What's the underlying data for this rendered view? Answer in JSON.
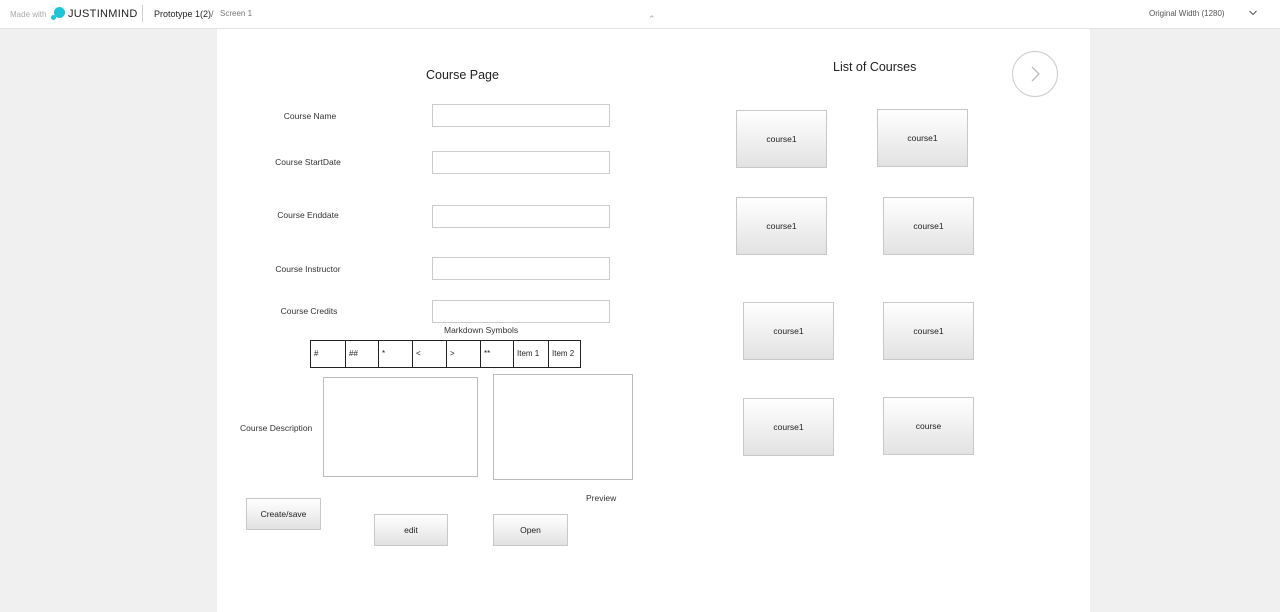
{
  "topbar": {
    "made_with": "Made with",
    "brand": "JUSTINMIND",
    "project": "Prototype 1(2)",
    "separator": "/",
    "screen": "Screen 1",
    "width_option": "Original Width (1280)"
  },
  "form": {
    "title": "Course Page",
    "fields": [
      {
        "label": "Course Name",
        "value": ""
      },
      {
        "label": "Course StartDate",
        "value": ""
      },
      {
        "label": "Course Enddate",
        "value": ""
      },
      {
        "label": "Course Instructor",
        "value": ""
      },
      {
        "label": "Course Credits",
        "value": ""
      }
    ],
    "markdown_title": "Markdown Symbols",
    "markdown_symbols": [
      "#",
      "##",
      "*",
      "<",
      ">",
      "**",
      "Item 1",
      "Item 2"
    ],
    "description_label": "Course Description",
    "description_value": "",
    "preview_label": "Preview",
    "buttons": {
      "create": "Create/save",
      "edit": "edit",
      "open": "Open"
    }
  },
  "courses": {
    "title": "List of Courses",
    "items": [
      "course1",
      "course1",
      "course1",
      "course1",
      "course1",
      "course1",
      "course1",
      "course"
    ]
  },
  "icons": {
    "next": "chevron-right-icon",
    "width_dropdown": "chevron-down-icon",
    "collapse": "chevron-up-icon"
  }
}
